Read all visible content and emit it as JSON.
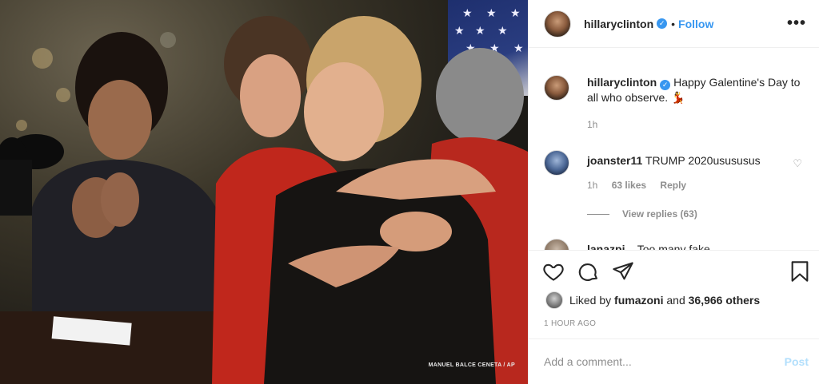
{
  "post": {
    "username": "hillaryclinton",
    "follow_label": "Follow",
    "more_label": "•••",
    "photo_credit": "MANUEL BALCE CENETA / AP"
  },
  "caption": {
    "username": "hillaryclinton",
    "text": "Happy Galentine's Day to all who observe. 💃",
    "time": "1h"
  },
  "comments": [
    {
      "username": "joanster11",
      "text": "TRUMP 2020usususus",
      "time": "1h",
      "likes": "63 likes",
      "reply_label": "Reply",
      "view_replies": "View replies (63)"
    },
    {
      "username": "lanazpi...",
      "text": "Too many fake..."
    }
  ],
  "likes": {
    "prefix": "Liked by",
    "user": "fumazoni",
    "middle": "and",
    "others": "36,966 others"
  },
  "timestamp": "1 HOUR AGO",
  "add_comment": {
    "placeholder": "Add a comment...",
    "post_label": "Post"
  },
  "colors": {
    "accent": "#3897f0",
    "post_disabled": "#b2dffc",
    "meta": "#8e8e8e"
  },
  "icons": [
    "heart-icon",
    "comment-icon",
    "share-icon",
    "bookmark-icon",
    "verified-icon"
  ]
}
